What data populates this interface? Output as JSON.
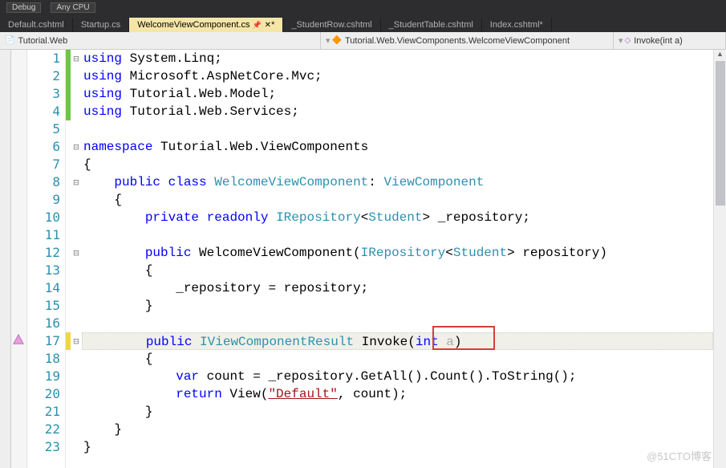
{
  "toolbar": {
    "config": "Debug",
    "platform": "Any CPU"
  },
  "tabs": [
    {
      "label": "Default.cshtml"
    },
    {
      "label": "Startup.cs"
    },
    {
      "label": "WelcomeViewComponent.cs",
      "active": true,
      "modified": true
    },
    {
      "label": "_StudentRow.cshtml"
    },
    {
      "label": "_StudentTable.cshtml"
    },
    {
      "label": "Index.cshtml",
      "modified": true
    }
  ],
  "nav": {
    "project": "Tutorial.Web",
    "class": "Tutorial.Web.ViewComponents.WelcomeViewComponent",
    "member": "Invoke(int a)"
  },
  "code": {
    "l1": "using System.Linq;",
    "l2": "using Microsoft.AspNetCore.Mvc;",
    "l3": "using Tutorial.Web.Model;",
    "l4": "using Tutorial.Web.Services;",
    "l5": "",
    "l6": "namespace Tutorial.Web.ViewComponents",
    "l7": "{",
    "l8": "    public class WelcomeViewComponent: ViewComponent",
    "l9": "    {",
    "l10": "        private readonly IRepository<Student> _repository;",
    "l11": "",
    "l12": "        public WelcomeViewComponent(IRepository<Student> repository)",
    "l13": "        {",
    "l14": "            _repository = repository;",
    "l15": "        }",
    "l16": "",
    "l17": "        public IViewComponentResult Invoke(int a)",
    "l18": "        {",
    "l19": "            var count = _repository.GetAll().Count().ToString();",
    "l20": "            return View(\"Default\", count);",
    "l21": "        }",
    "l22": "    }",
    "l23": "}"
  },
  "line_numbers": [
    "1",
    "2",
    "3",
    "4",
    "5",
    "6",
    "7",
    "8",
    "9",
    "10",
    "11",
    "12",
    "13",
    "14",
    "15",
    "16",
    "17",
    "18",
    "19",
    "20",
    "21",
    "22",
    "23"
  ],
  "watermark": "@51CTO博客"
}
